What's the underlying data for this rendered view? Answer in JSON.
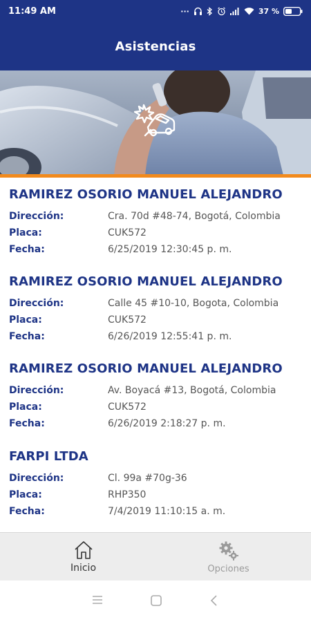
{
  "status_bar": {
    "time": "11:49 AM",
    "battery": "37 %"
  },
  "app_bar": {
    "title": "Asistencias"
  },
  "labels": {
    "direccion": "Dirección:",
    "placa": "Placa:",
    "fecha": "Fecha:"
  },
  "items": [
    {
      "name": "RAMIREZ OSORIO MANUEL ALEJANDRO",
      "direccion": "Cra. 70d #48-74, Bogotá, Colombia",
      "placa": "CUK572",
      "fecha": "6/25/2019 12:30:45 p. m."
    },
    {
      "name": "RAMIREZ OSORIO MANUEL ALEJANDRO",
      "direccion": "Calle 45 #10-10, Bogota, Colombia",
      "placa": "CUK572",
      "fecha": "6/26/2019 12:55:41 p. m."
    },
    {
      "name": "RAMIREZ OSORIO MANUEL ALEJANDRO",
      "direccion": "Av. Boyacá #13, Bogotá, Colombia",
      "placa": "CUK572",
      "fecha": "6/26/2019 2:18:27 p. m."
    },
    {
      "name": "FARPI LTDA",
      "direccion": "Cl. 99a #70g-36",
      "placa": "RHP350",
      "fecha": "7/4/2019 11:10:15 a. m."
    }
  ],
  "bottom_nav": {
    "inicio": "Inicio",
    "opciones": "Opciones"
  },
  "icons": {
    "home": "home-icon",
    "options": "gears-icon",
    "banner": "car-crash-icon"
  },
  "colors": {
    "primary": "#1e3486",
    "accent": "#f28a1c",
    "value_text": "#555555"
  }
}
